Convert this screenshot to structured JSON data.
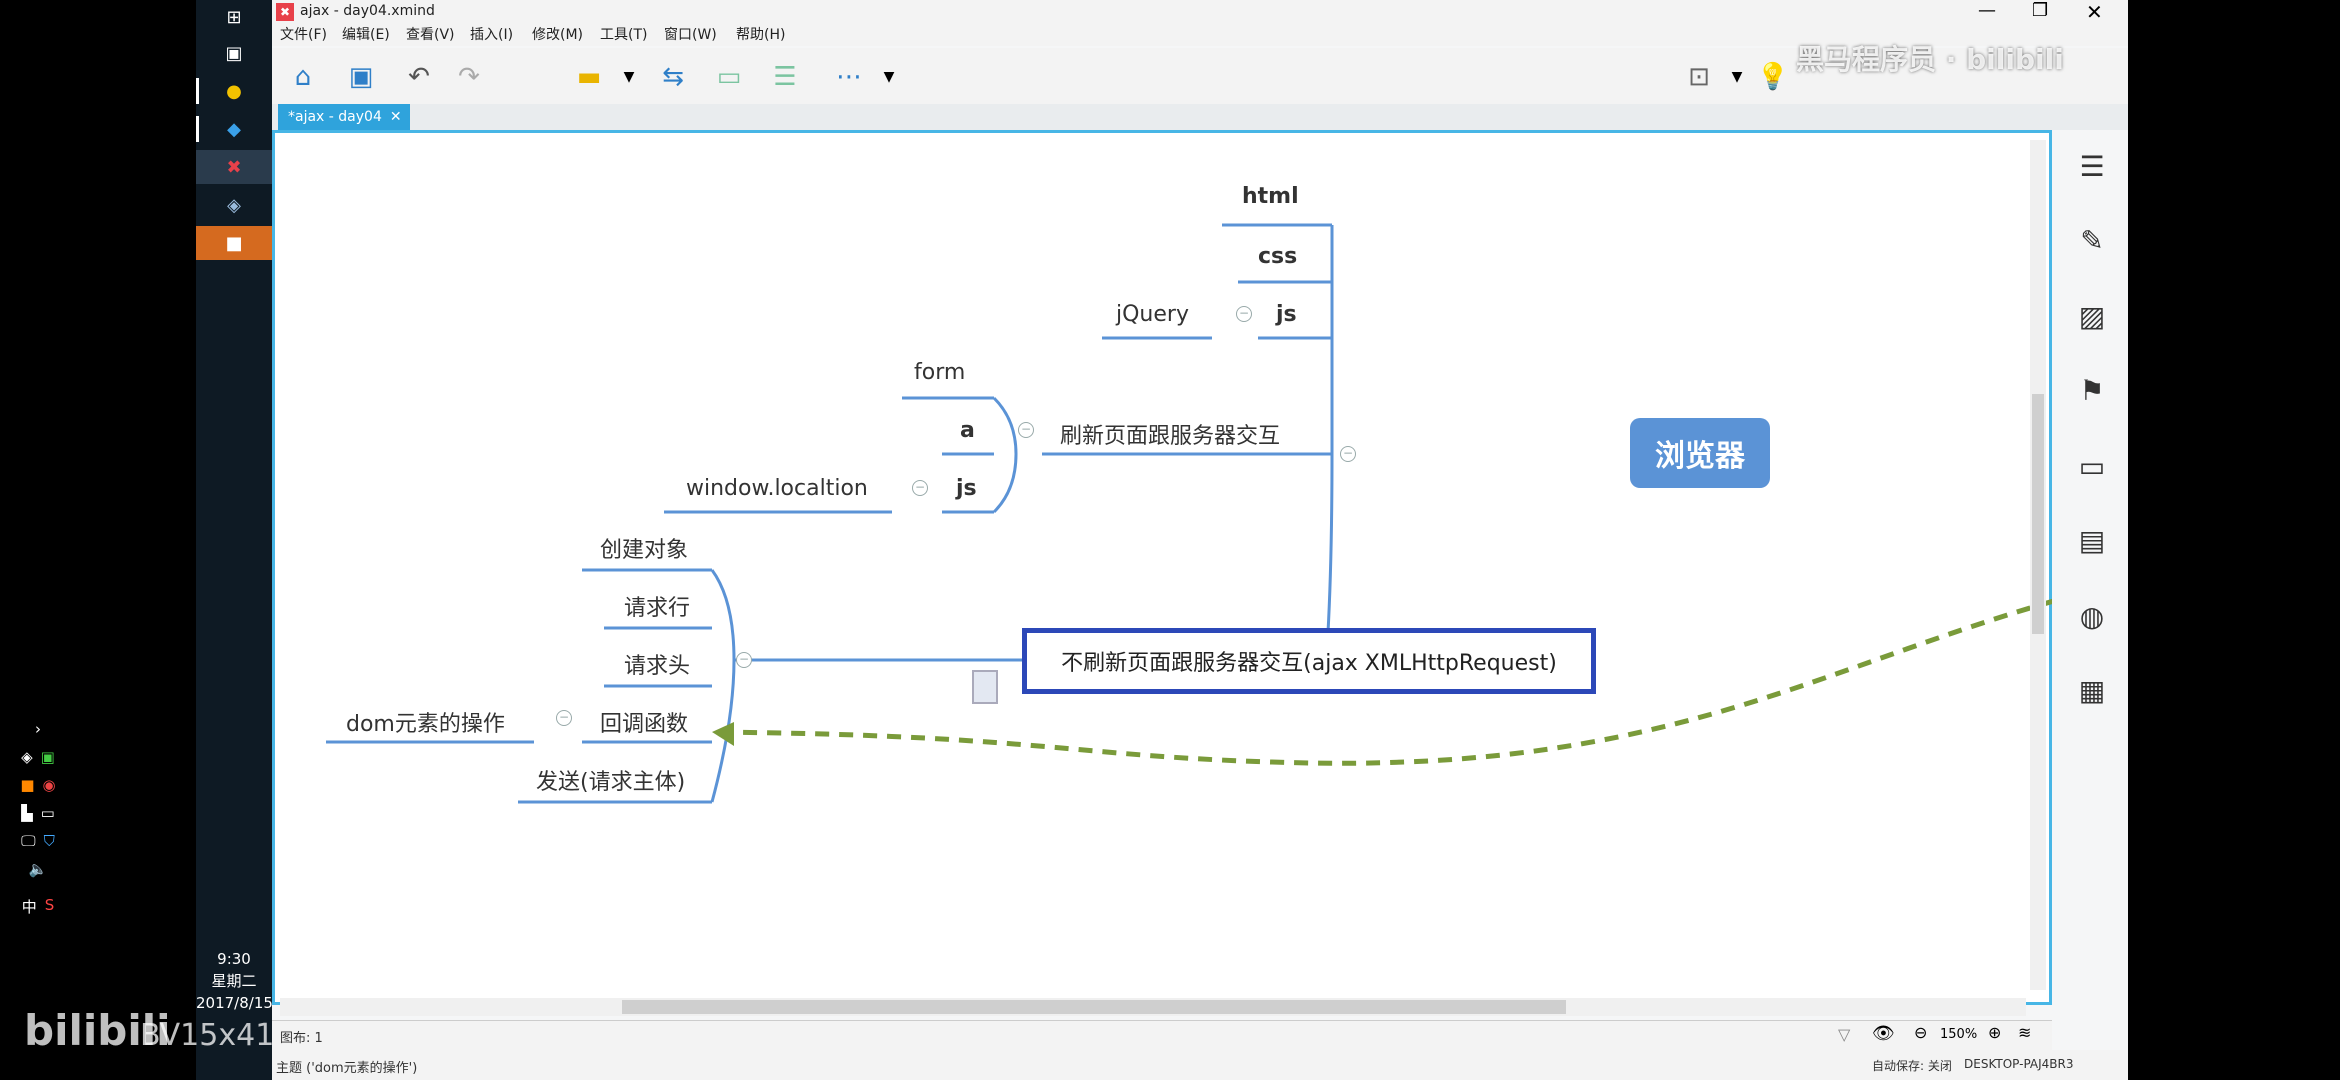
{
  "window": {
    "title": "ajax - day04.xmind"
  },
  "menu": [
    "文件(F)",
    "编辑(E)",
    "查看(V)",
    "插入(I)",
    "修改(M)",
    "工具(T)",
    "窗口(W)",
    "帮助(H)"
  ],
  "tab": {
    "label": "*ajax - day04"
  },
  "mindmap": {
    "center": "浏览器",
    "browser_children": {
      "html": "html",
      "css": "css",
      "js": "js",
      "jquery": "jQuery"
    },
    "refresh_branch": {
      "label": "刷新页面跟服务器交互",
      "children": [
        "form",
        "a",
        "js"
      ],
      "js_child": "window.localtion"
    },
    "ajax_branch": {
      "label": "不刷新页面跟服务器交互(ajax XMLHttpRequest)",
      "children": [
        "创建对象",
        "请求行",
        "请求头",
        "回调函数",
        "发送(请求主体)"
      ],
      "callback_child": "dom元素的操作"
    }
  },
  "status": {
    "sheet": "图布: 1",
    "zoom": "150%"
  },
  "bottom": {
    "topic": "主题 ('dom元素的操作')",
    "autosave": "自动保存: 关闭",
    "computer": "DESKTOP-PAJ4BR3"
  },
  "taskbar": {
    "time": "9:30",
    "weekday": "星期二",
    "date": "2017/8/15",
    "ime": "中"
  },
  "watermark": {
    "bilibili": "bilibili",
    "bv": "BV15x41",
    "brand": "黑马程序员 · bilibili"
  }
}
